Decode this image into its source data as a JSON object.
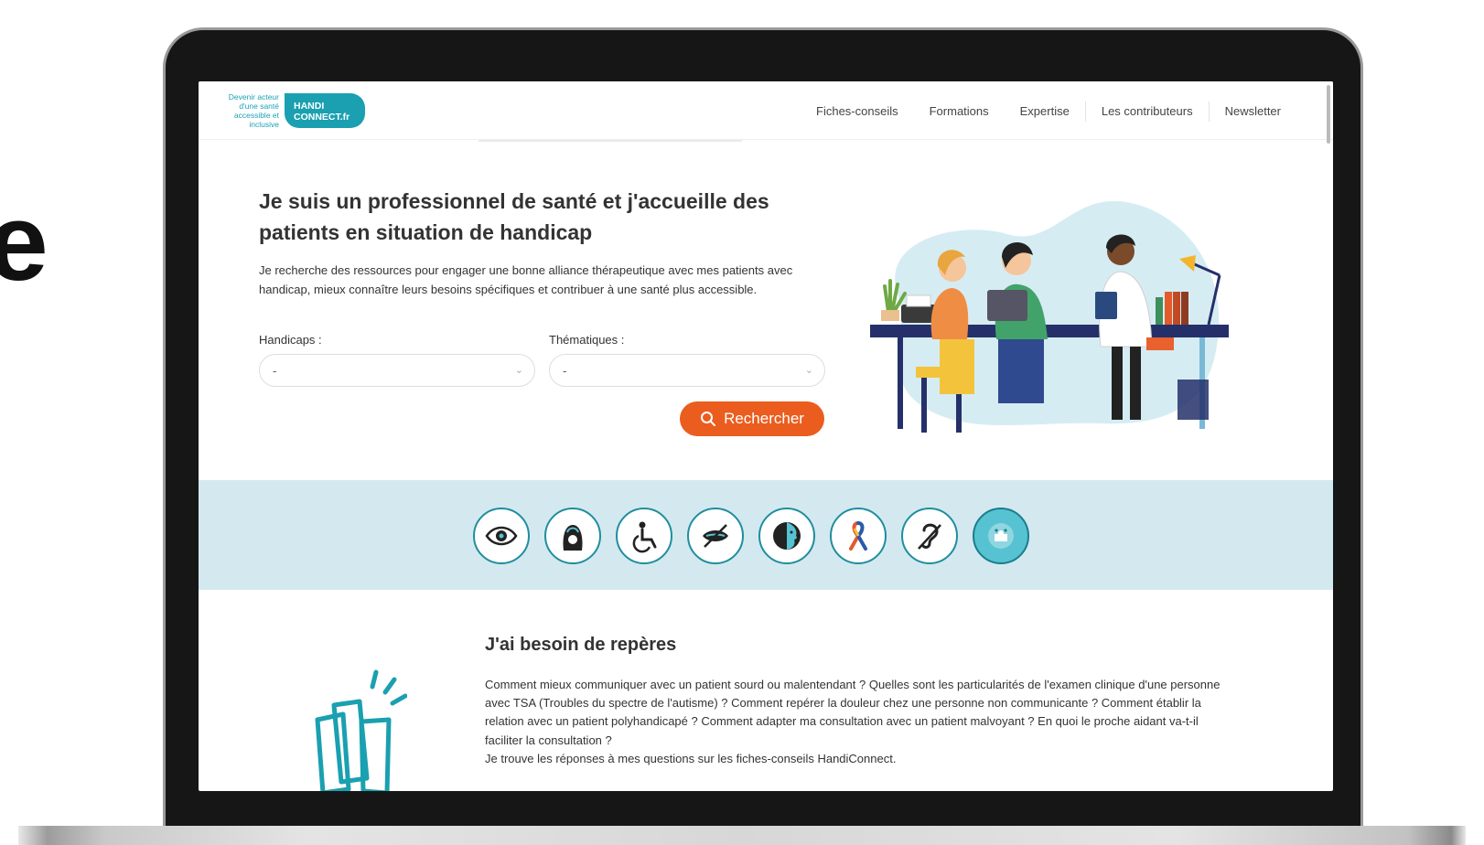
{
  "page": {
    "stray_letter": "e"
  },
  "header": {
    "tagline": "Devenir acteur d'une santé accessible et inclusive",
    "brand_line1": "HANDI",
    "brand_line2": "CONNECT.fr",
    "nav": [
      "Fiches-conseils",
      "Formations",
      "Expertise",
      "Les contributeurs",
      "Newsletter"
    ]
  },
  "hero": {
    "title": "Je suis un professionnel de santé et j'accueille des patients en situation de handicap",
    "text": "Je recherche des ressources pour engager une bonne alliance thérapeutique avec mes patients avec handicap, mieux connaître leurs besoins spécifiques et contribuer à une santé plus accessible.",
    "filter_handicaps_label": "Handicaps :",
    "filter_handicaps_value": "-",
    "filter_thematiques_label": "Thématiques :",
    "filter_thematiques_value": "-",
    "search_button": "Rechercher"
  },
  "handicap_icons": [
    {
      "name": "eye-icon"
    },
    {
      "name": "cognitive-head-icon"
    },
    {
      "name": "wheelchair-icon"
    },
    {
      "name": "speech-mouth-icon"
    },
    {
      "name": "face-profile-icon"
    },
    {
      "name": "autism-ribbon-icon"
    },
    {
      "name": "hearing-ear-icon"
    },
    {
      "name": "puzzle-head-icon"
    }
  ],
  "section": {
    "title": "J'ai besoin de repères",
    "text": "Comment mieux communiquer avec un patient sourd ou malentendant ? Quelles sont les particularités de l'examen clinique d'une personne avec TSA (Troubles du spectre de l'autisme) ? Comment repérer la douleur chez une personne non communicante ? Comment établir la relation avec un patient polyhandicapé ? Comment adapter ma consultation avec un patient malvoyant ? En quoi le proche aidant va-t-il faciliter la consultation ?",
    "text_link": "Je trouve les réponses à mes questions sur les fiches-conseils HandiConnect."
  },
  "colors": {
    "brand_teal": "#1aa0b0",
    "accent_orange": "#ea5d1f",
    "band_bg": "#d3e9ef",
    "laptop_bezel": "#161616"
  }
}
